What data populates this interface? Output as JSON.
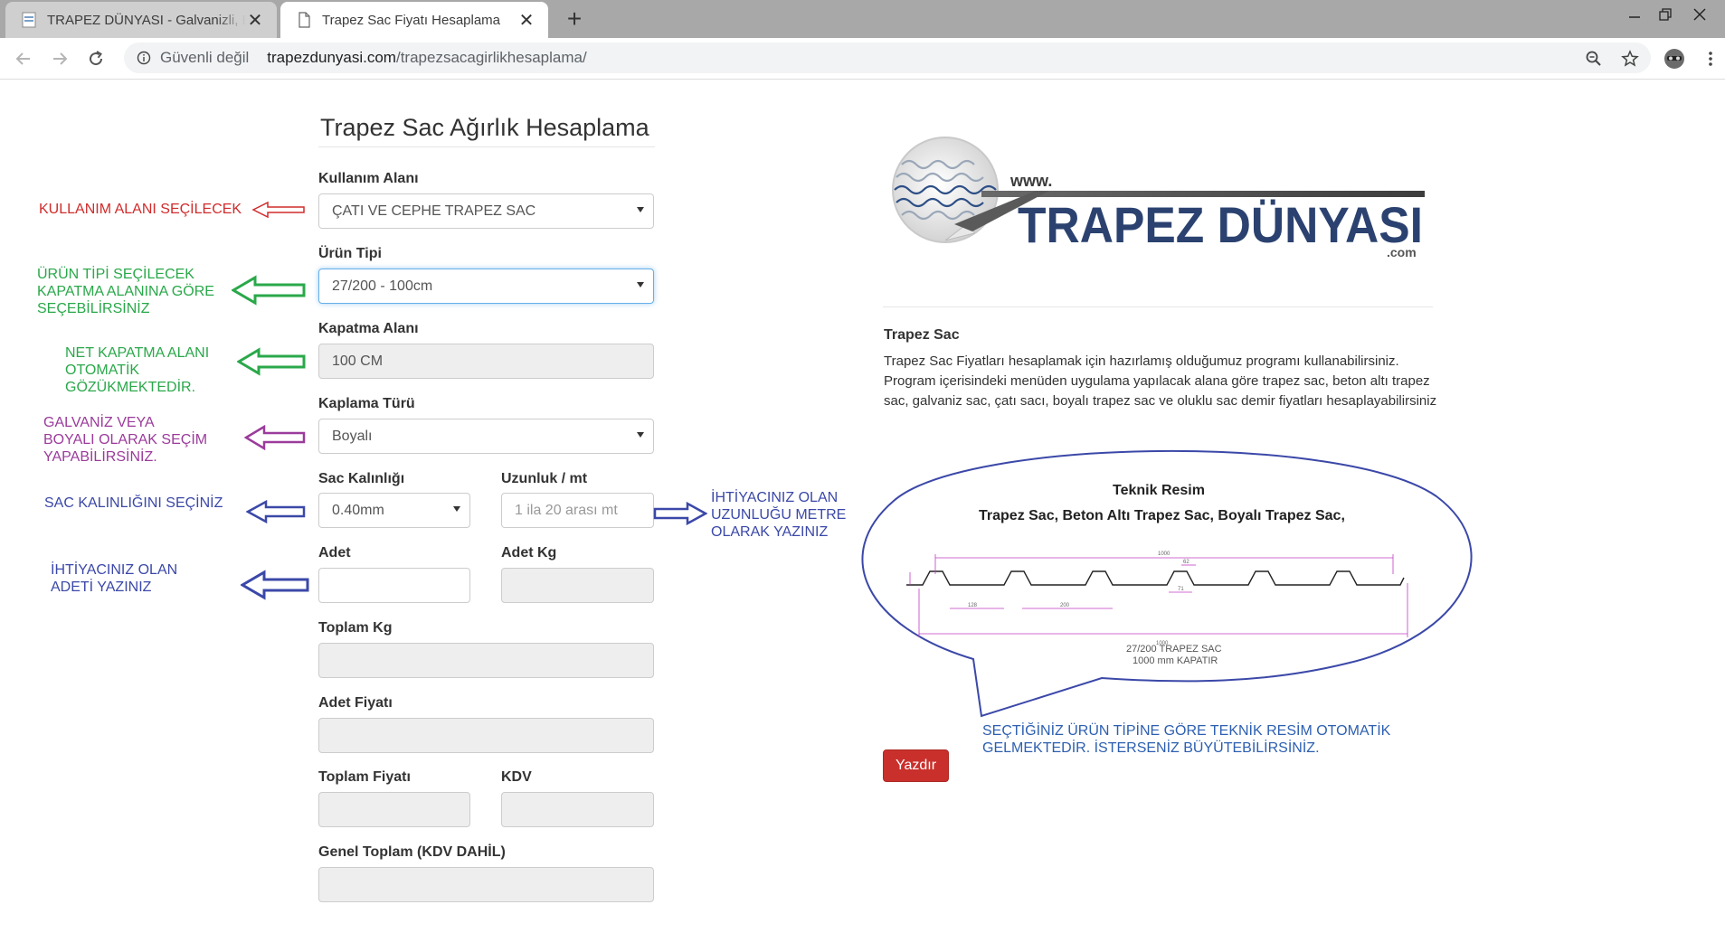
{
  "browser": {
    "tabs": [
      {
        "title": "TRAPEZ DÜNYASI - Galvanizli, Boyalı Trapez Sac",
        "active": false
      },
      {
        "title": "Trapez Sac Fiyatı Hesaplama",
        "active": true
      }
    ],
    "security_label": "Güvenli değil",
    "url_domain": "trapezdunyasi.com",
    "url_path": "/trapezsacagirlikhesaplama/"
  },
  "page": {
    "title": "Trapez Sac Ağırlık Hesaplama"
  },
  "form": {
    "kullanim_alani": {
      "label": "Kullanım Alanı",
      "value": "ÇATI VE CEPHE TRAPEZ SAC"
    },
    "urun_tipi": {
      "label": "Ürün Tipi",
      "value": "27/200 - 100cm"
    },
    "kapatma_alani": {
      "label": "Kapatma Alanı",
      "value": "100 CM"
    },
    "kaplama_turu": {
      "label": "Kaplama Türü",
      "value": "Boyalı"
    },
    "sac_kalinligi": {
      "label": "Sac Kalınlığı",
      "value": "0.40mm"
    },
    "uzunluk": {
      "label": "Uzunluk / mt",
      "placeholder": "1 ila 20 arası mt"
    },
    "adet": {
      "label": "Adet",
      "value": ""
    },
    "adet_kg": {
      "label": "Adet Kg",
      "value": ""
    },
    "toplam_kg": {
      "label": "Toplam Kg",
      "value": ""
    },
    "adet_fiyati": {
      "label": "Adet Fiyatı",
      "value": ""
    },
    "toplam_fiyati": {
      "label": "Toplam Fiyatı",
      "value": ""
    },
    "kdv": {
      "label": "KDV",
      "value": ""
    },
    "genel_toplam": {
      "label": "Genel Toplam (KDV DAHİL)",
      "value": ""
    }
  },
  "annotations": {
    "kullanim": "KULLANIM ALANI SEÇİLECEK",
    "urun": [
      "ÜRÜN TİPİ SEÇİLECEK",
      "KAPATMA ALANINA GÖRE",
      "SEÇEBİLİRSİNİZ"
    ],
    "kapatma": [
      "NET KAPATMA ALANI",
      "OTOMATİK",
      "GÖZÜKMEKTEDİR."
    ],
    "kaplama": [
      "GALVANİZ VEYA",
      "BOYALI OLARAK SEÇİM",
      "YAPABİLİRSİNİZ."
    ],
    "kalinlik": "SAC KALINLIĞINI SEÇİNİZ",
    "uzunluk": [
      "İHTİYACINIZ OLAN",
      "UZUNLUĞU METRE",
      "OLARAK YAZINIZ"
    ],
    "adet": [
      "İHTİYACINIZ OLAN",
      "ADETİ YAZINIZ"
    ],
    "resim": [
      "SEÇTİĞİNİZ ÜRÜN TİPİNE GÖRE TEKNİK RESİM OTOMATİK",
      "GELMEKTEDİR. İSTERSENİZ BÜYÜTEBİLİRSİNİZ."
    ],
    "colors": {
      "red": "#d12b2b",
      "green": "#2aa84a",
      "purple": "#9b3b9b",
      "blue": "#3b48a8"
    }
  },
  "info": {
    "logo_top": "www.",
    "logo_main": "TRAPEZ DÜNYASI",
    "logo_com": ".com",
    "title": "Trapez Sac",
    "text": "Trapez Sac Fiyatları hesaplamak için hazırlamış olduğumuz programı kullanabilirsiniz. Program içerisindeki menüden uygulama yapılacak alana göre trapez sac, beton altı trapez sac, galvaniz sac, çatı sacı, boyalı trapez sac ve oluklu sac demir fiyatları hesaplayabilirsiniz"
  },
  "teknik_resim": {
    "title": "Teknik Resim",
    "subtitle": "Trapez Sac, Beton Altı Trapez Sac, Boyalı Trapez Sac,",
    "caption_line1": "27/200  TRAPEZ SAC",
    "caption_line2": "1000 mm KAPATIR"
  },
  "print_button": "Yazdır"
}
